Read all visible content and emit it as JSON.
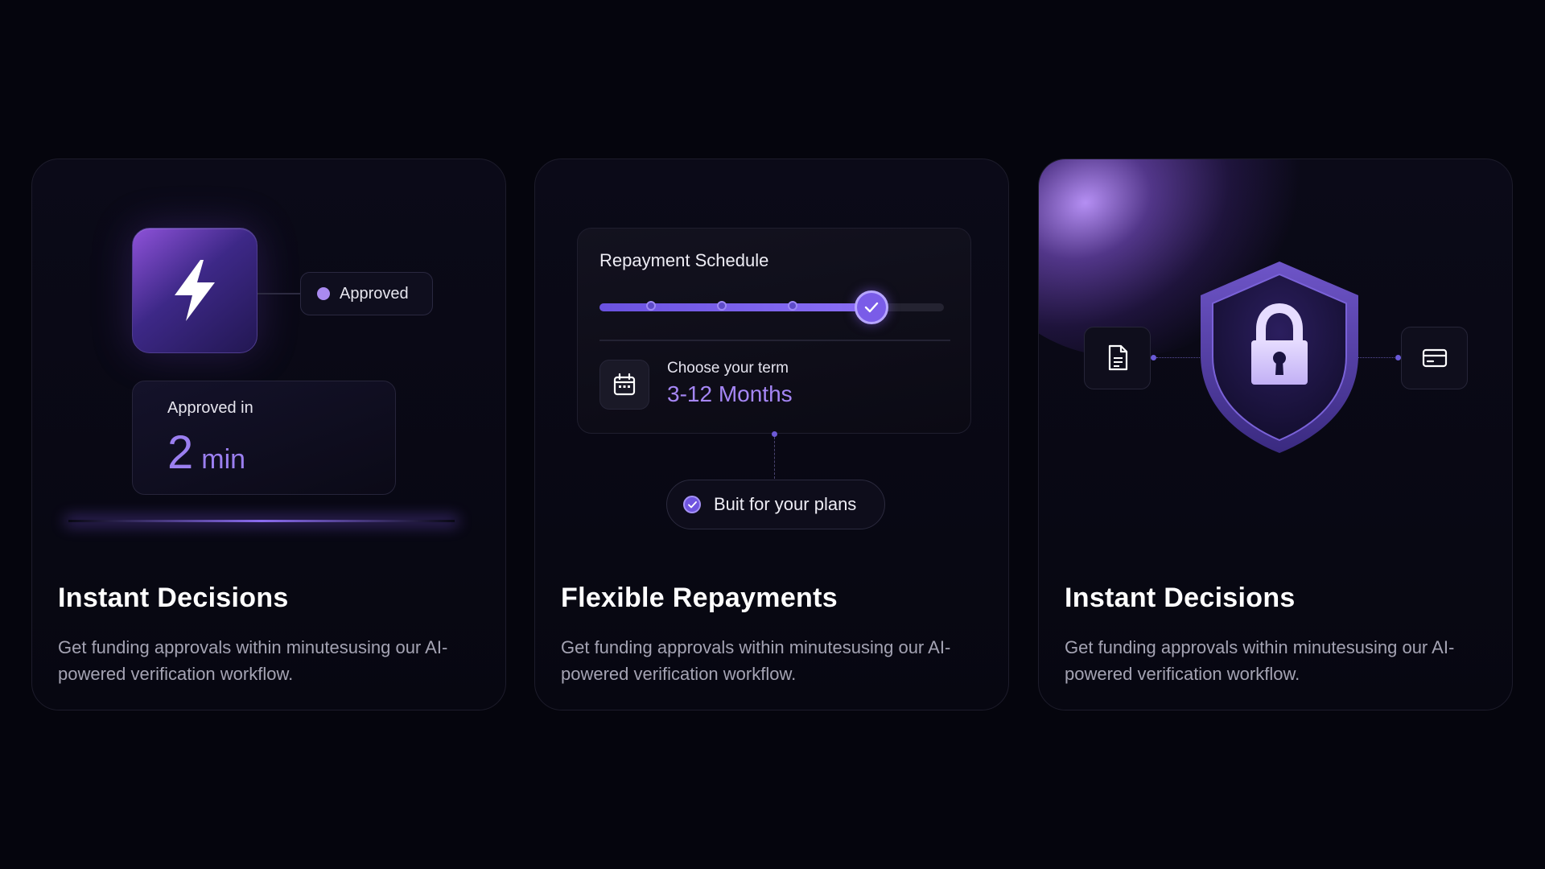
{
  "colors": {
    "background": "#05050d",
    "accent": "#9b7ff0",
    "accent_bright": "#a586f5",
    "text_primary": "#ffffff",
    "text_secondary": "#a4a3b3"
  },
  "cards": [
    {
      "title": "Instant Decisions",
      "description": "Get funding approvals within minutesusing our AI-powered verification workflow.",
      "icon": "lightning-bolt-icon",
      "badge_label": "Approved",
      "stat_label": "Approved in",
      "stat_value": "2",
      "stat_unit": "min"
    },
    {
      "title": "Flexible Repayments",
      "description": "Get funding approvals within minutesusing our AI-powered verification workflow.",
      "panel_title": "Repayment Schedule",
      "slider_progress": 0.79,
      "slider_markers": [
        0.15,
        0.355,
        0.56
      ],
      "term_label": "Choose your term",
      "term_value": "3-12 Months",
      "term_icon": "calendar-icon",
      "pill_label": "Buit for your plans",
      "pill_icon": "check-circle-icon"
    },
    {
      "title": "Instant Decisions",
      "description": "Get funding approvals within minutesusing our AI-powered verification workflow.",
      "center_icon": "shield-lock-icon",
      "left_icon": "document-icon",
      "right_icon": "credit-card-icon"
    }
  ]
}
